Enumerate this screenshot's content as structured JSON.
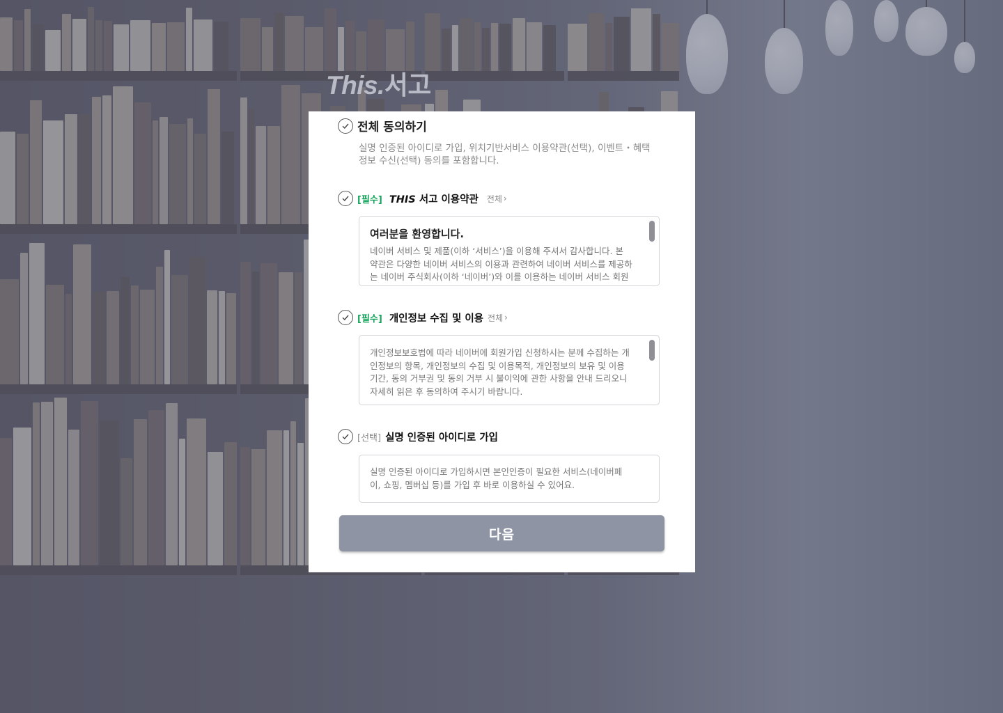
{
  "logo": {
    "en": "This.",
    "ko": "서고"
  },
  "agree_all": {
    "label": "전체 동의하기",
    "description": "실명 인증된 아이디로 가입, 위치기반서비스 이용약관(선택), 이벤트・혜택 정보 수신(선택) 동의를 포함합니다."
  },
  "terms": {
    "tag": "[필수]",
    "title_italic": "THIS",
    "title_rest": " 서고 이용약관",
    "more": "전체",
    "box_title": "여러분을 환영합니다.",
    "box_text": "네이버 서비스 및 제품(이하 ‘서비스’)을 이용해 주셔서 감사합니다. 본 약관은 다양한 네이버 서비스의 이용과 관련하여 네이버 서비스를 제공하는 네이버 주식회사(이하 ‘네이버’)와 이를 이용하는 네이버 서비스 회원(이하 ‘회원’) 또는 비회원과의 관계를 설명하며, 아울러"
  },
  "privacy": {
    "tag": "[필수]",
    "title": "개인정보 수집 및 이용",
    "more": "전체",
    "box_text": "개인정보보호법에 따라 네이버에 회원가입 신청하시는 분께 수집하는 개인정보의 항목, 개인정보의 수집 및 이용목적, 개인정보의 보유 및 이용기간, 동의 거부권 및 동의 거부 시 불이익에 관한 사항을 안내 드리오니 자세히 읽은 후 동의하여 주시기 바랍니다."
  },
  "realname": {
    "tag": "[선택]",
    "title": "실명 인증된 아이디로 가입",
    "box_text": "실명 인증된 아이디로 가입하시면 본인인증이 필요한 서비스(네이버페이, 쇼핑, 멤버십 등)를 가입 후 바로 이용하실 수 있어요."
  },
  "next_button": "다음",
  "colors": {
    "required_tag": "#14a35a",
    "button": "#8e94a3",
    "card": "#ffffff"
  },
  "icons": [
    "check-circle-icon",
    "chevron-right-icon"
  ]
}
